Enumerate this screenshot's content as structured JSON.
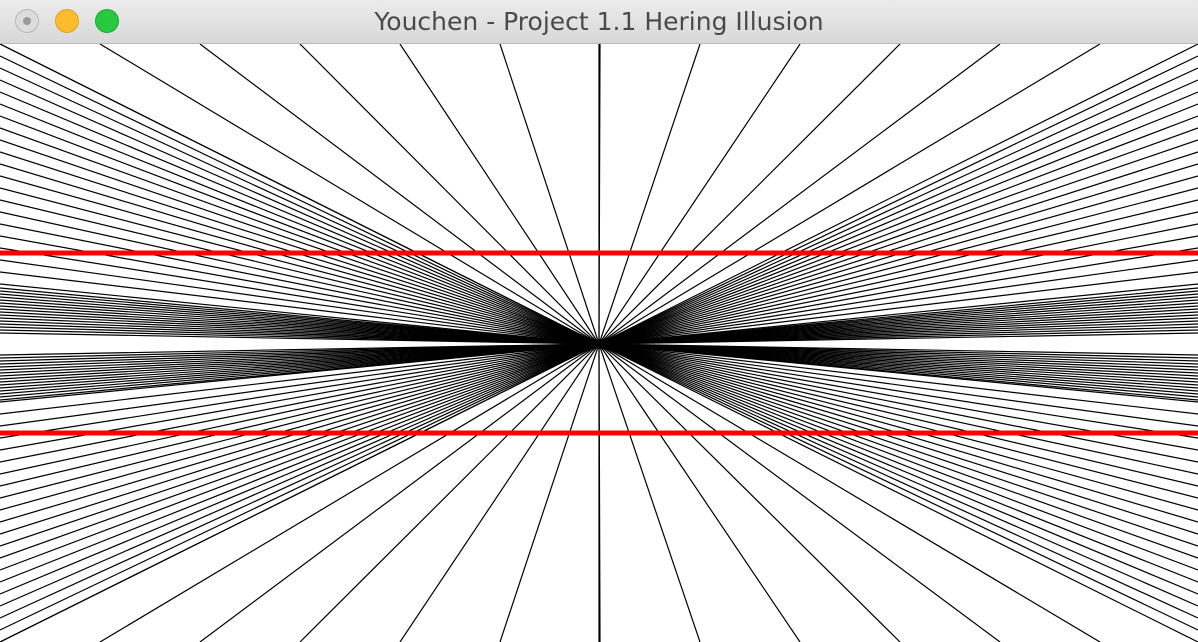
{
  "window": {
    "title": "Youchen - Project 1.1 Hering Illusion",
    "controls": {
      "close": "close-button",
      "minimize": "minimize-button",
      "zoom": "zoom-button"
    }
  },
  "illusion": {
    "ray_color": "#000000",
    "parallel_line_color": "#ff0000",
    "parallel_line_count": 2
  }
}
